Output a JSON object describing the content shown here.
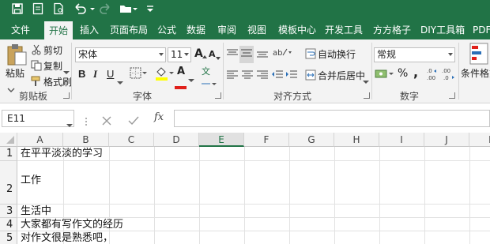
{
  "tabs": [
    "文件",
    "开始",
    "插入",
    "页面布局",
    "公式",
    "数据",
    "审阅",
    "视图",
    "模板中心",
    "开发工具",
    "方方格子",
    "DIY工具箱",
    "PDF"
  ],
  "active_tab": "开始",
  "clipboard": {
    "paste": "粘贴",
    "cut": "剪切",
    "copy": "复制",
    "format_painter": "格式刷",
    "group": "剪贴板"
  },
  "font": {
    "name": "宋体",
    "size": "11",
    "bold": "B",
    "italic": "I",
    "underline": "U",
    "grow": "A",
    "shrink": "A",
    "group": "字体",
    "font_color_letter": "A",
    "wen": "文"
  },
  "alignment": {
    "wrap": "自动换行",
    "merge": "合并后居中",
    "group": "对齐方式"
  },
  "number": {
    "format": "常规",
    "percent": "%",
    "comma": ",",
    "group": "数字"
  },
  "styles": {
    "conditional": "条件格式"
  },
  "formula_bar": {
    "name_box": "E11",
    "fx": "fx",
    "content": ""
  },
  "columns": [
    "A",
    "B",
    "C",
    "D",
    "E",
    "F",
    "G",
    "H",
    "I",
    "J",
    "K"
  ],
  "selected_column": "E",
  "rows": [
    {
      "num": "1",
      "text": "在平平淡淡的学习"
    },
    {
      "num": "2",
      "text": "工作"
    },
    {
      "num": "3",
      "text": "生活中"
    },
    {
      "num": "4",
      "text": "大家都有写作文的经历"
    },
    {
      "num": "5",
      "text": "对作文很是熟悉吧，"
    }
  ],
  "colors": {
    "brand": "#217346",
    "ribbon": "#f3f3f3"
  }
}
